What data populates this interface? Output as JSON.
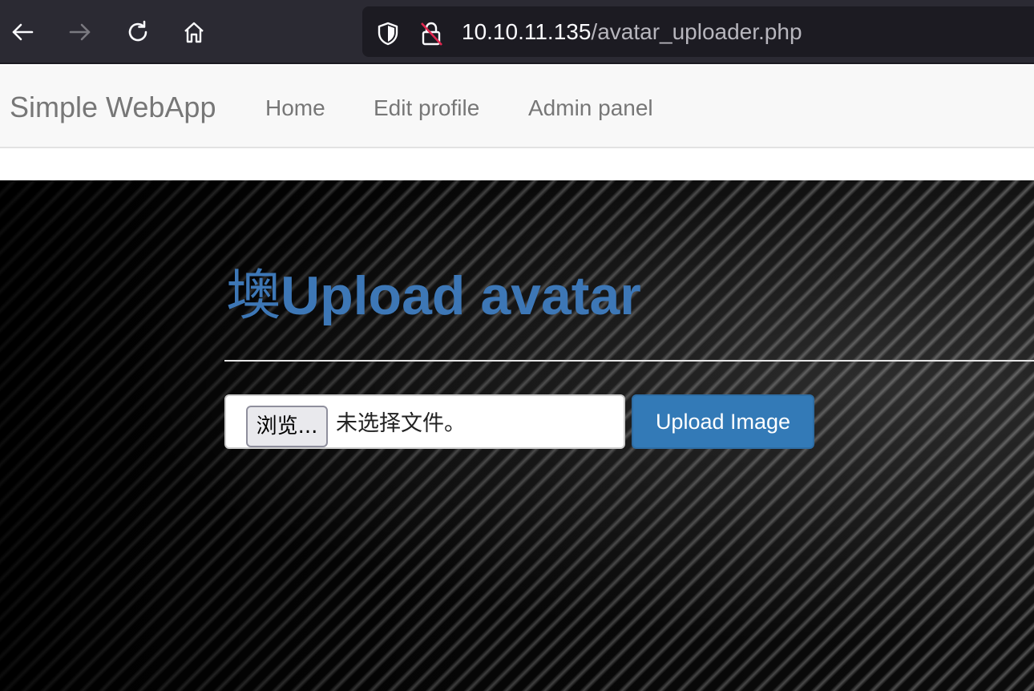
{
  "browser": {
    "url_host": "10.10.11.135",
    "url_path": "/avatar_uploader.php",
    "icons": [
      "back-arrow-icon",
      "forward-arrow-icon",
      "reload-icon",
      "home-icon",
      "shield-icon",
      "insecure-lock-icon"
    ]
  },
  "navbar": {
    "brand": "Simple WebApp",
    "links": [
      {
        "label": "Home"
      },
      {
        "label": "Edit profile"
      },
      {
        "label": "Admin panel"
      }
    ]
  },
  "main": {
    "heading_glyph": "墺",
    "heading": "Upload avatar",
    "file_input": {
      "browse_label": "浏览...",
      "status": "未选择文件。"
    },
    "upload_button": "Upload Image"
  },
  "colors": {
    "accent": "#337ab7",
    "heading": "#3d77b6",
    "browser_chrome": "#2b2a33"
  }
}
